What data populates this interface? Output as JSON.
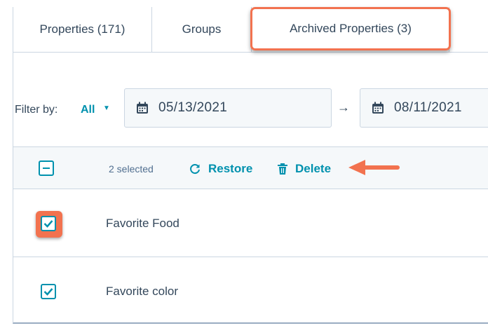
{
  "tabs": [
    {
      "label": "Properties (171)",
      "active": false
    },
    {
      "label": "Groups",
      "active": false
    },
    {
      "label": "Archived Properties (3)",
      "active": true
    }
  ],
  "filter": {
    "label": "Filter by:",
    "selected": "All",
    "start_date": "05/13/2021",
    "end_date": "08/11/2021",
    "calendar_icon": "calendar-icon",
    "range_arrow": "→"
  },
  "bulk_actions": {
    "selected_count": "2 selected",
    "restore_label": "Restore",
    "delete_label": "Delete",
    "restore_icon": "refresh-icon",
    "delete_icon": "trash-icon"
  },
  "rows": [
    {
      "label": "Favorite Food",
      "checked": true,
      "highlighted": true
    },
    {
      "label": "Favorite color",
      "checked": true,
      "highlighted": false
    }
  ],
  "colors": {
    "accent": "#0091ae",
    "highlight": "#f2724f",
    "text": "#33475b",
    "border": "#cbd6e2",
    "header_bg": "#f5f8fa"
  }
}
